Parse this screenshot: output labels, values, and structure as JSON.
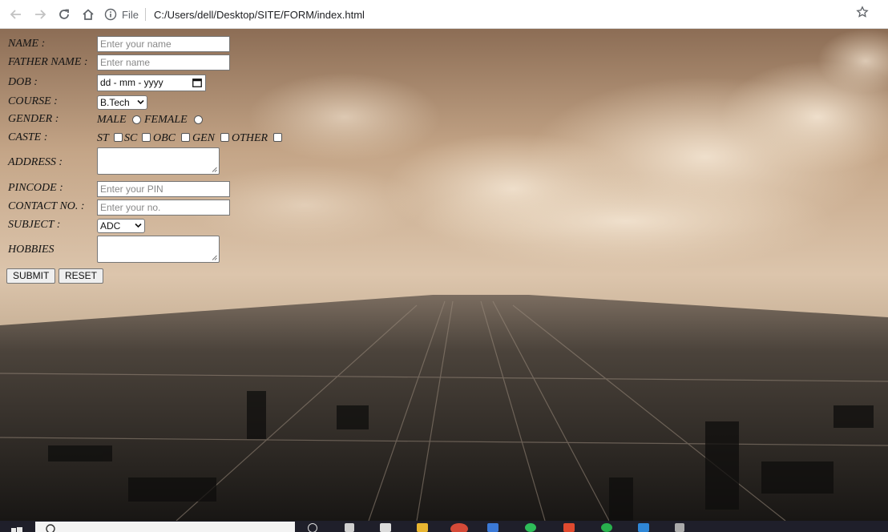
{
  "browser": {
    "nav_icons": [
      "back-arrow-icon",
      "forward-arrow-icon",
      "reload-icon",
      "home-icon"
    ],
    "info_icon": "info-icon",
    "file_label": "File",
    "address": "C:/Users/dell/Desktop/SITE/FORM/index.html",
    "bookmark_icon": "star-icon"
  },
  "form": {
    "name_label": "NAME :",
    "name_placeholder": "Enter your name",
    "father_label": "FATHER NAME :",
    "father_placeholder": "Enter name",
    "dob_label": "DOB :",
    "dob_value": "dd - mm - yyyy",
    "course_label": "COURSE :",
    "course_selected": "B.Tech",
    "gender_label": "GENDER :",
    "gender_options": [
      "MALE",
      "FEMALE"
    ],
    "caste_label": "CASTE :",
    "caste_options": [
      "ST",
      "SC",
      "OBC",
      "GEN",
      "OTHER"
    ],
    "address_label": "ADDRESS :",
    "pincode_label": "PINCODE :",
    "pincode_placeholder": "Enter your PIN",
    "contact_label": "CONTACT NO. :",
    "contact_placeholder": "Enter your no.",
    "subject_label": "SUBJECT :",
    "subject_selected": "ADC",
    "hobbies_label": "HOBBIES",
    "submit_label": "SUBMIT",
    "reset_label": "RESET"
  },
  "colors": {
    "sky": "#c9ad8c",
    "city": "#2a2622",
    "taskbar": "#1f1f2a"
  }
}
